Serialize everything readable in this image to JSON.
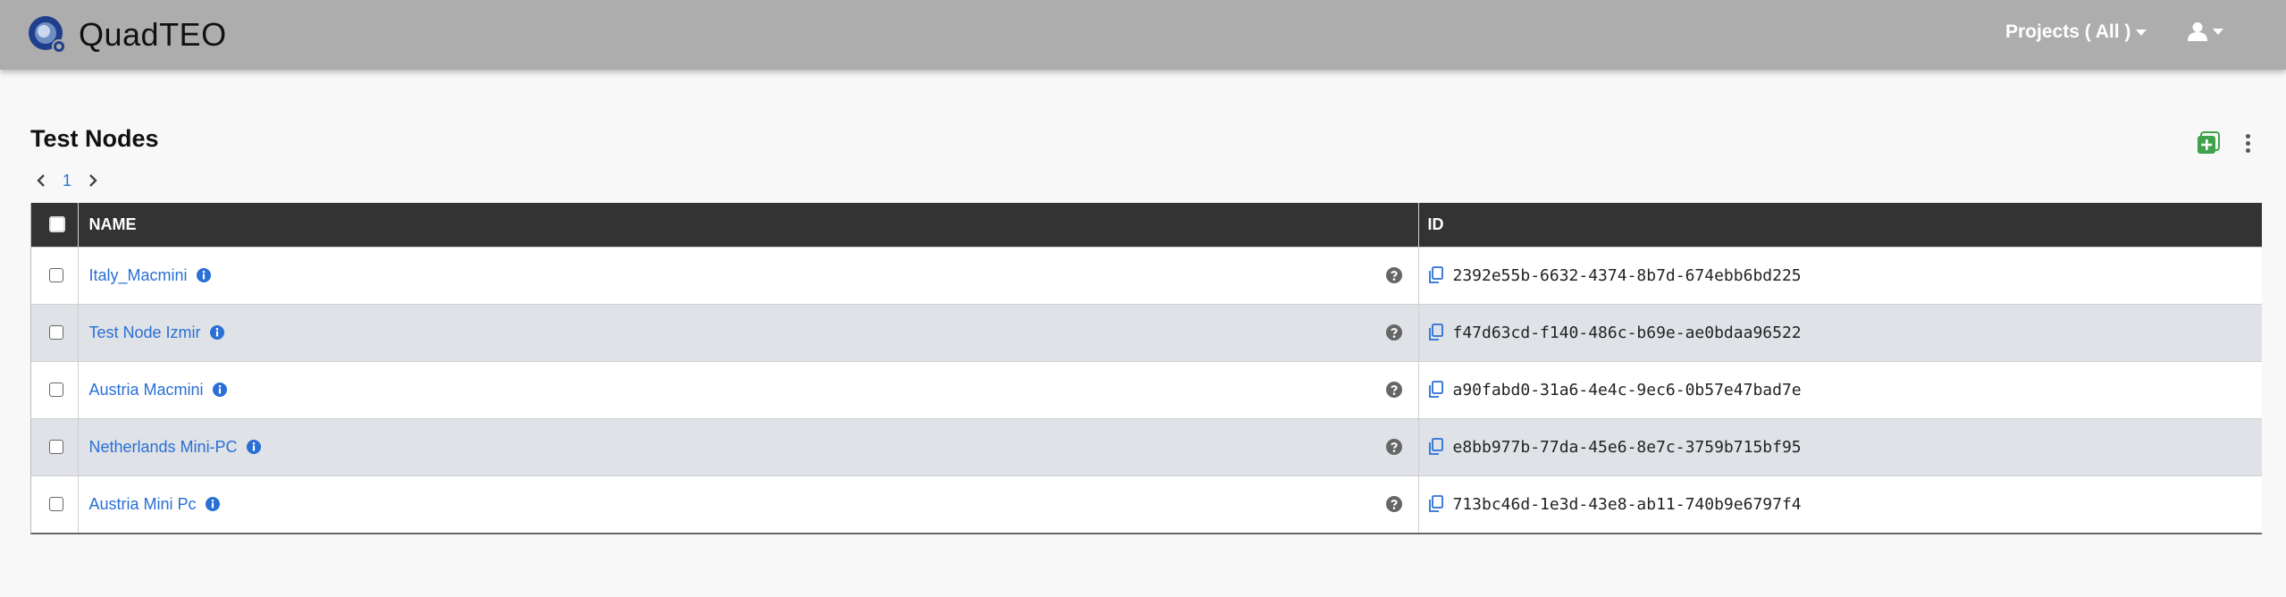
{
  "app": {
    "brand": "QuadTEO",
    "nav_projects": "Projects ( All )"
  },
  "page": {
    "title": "Test Nodes",
    "current_page": "1"
  },
  "table": {
    "headers": {
      "name": "NAME",
      "id": "ID"
    },
    "rows": [
      {
        "name": "Italy_Macmini",
        "id": "2392e55b-6632-4374-8b7d-674ebb6bd225"
      },
      {
        "name": "Test Node Izmir",
        "id": "f47d63cd-f140-486c-b69e-ae0bdaa96522"
      },
      {
        "name": "Austria Macmini",
        "id": "a90fabd0-31a6-4e4c-9ec6-0b57e47bad7e"
      },
      {
        "name": "Netherlands Mini-PC",
        "id": "e8bb977b-77da-45e6-8e7c-3759b715bf95"
      },
      {
        "name": "Austria Mini Pc",
        "id": "713bc46d-1e3d-43e8-ab11-740b9e6797f4"
      }
    ]
  },
  "icons": {
    "logo": "quadteo-logo-icon",
    "user": "user-icon",
    "add": "add-square-icon",
    "more": "kebab-menu-icon",
    "info": "info-circle-icon",
    "help": "question-circle-icon",
    "copy": "copy-icon"
  },
  "colors": {
    "navbar": "#adadad",
    "header_bg": "#333333",
    "link": "#2a6fd6",
    "add_green": "#3fa34d",
    "row_alt": "#dfe2e6"
  }
}
